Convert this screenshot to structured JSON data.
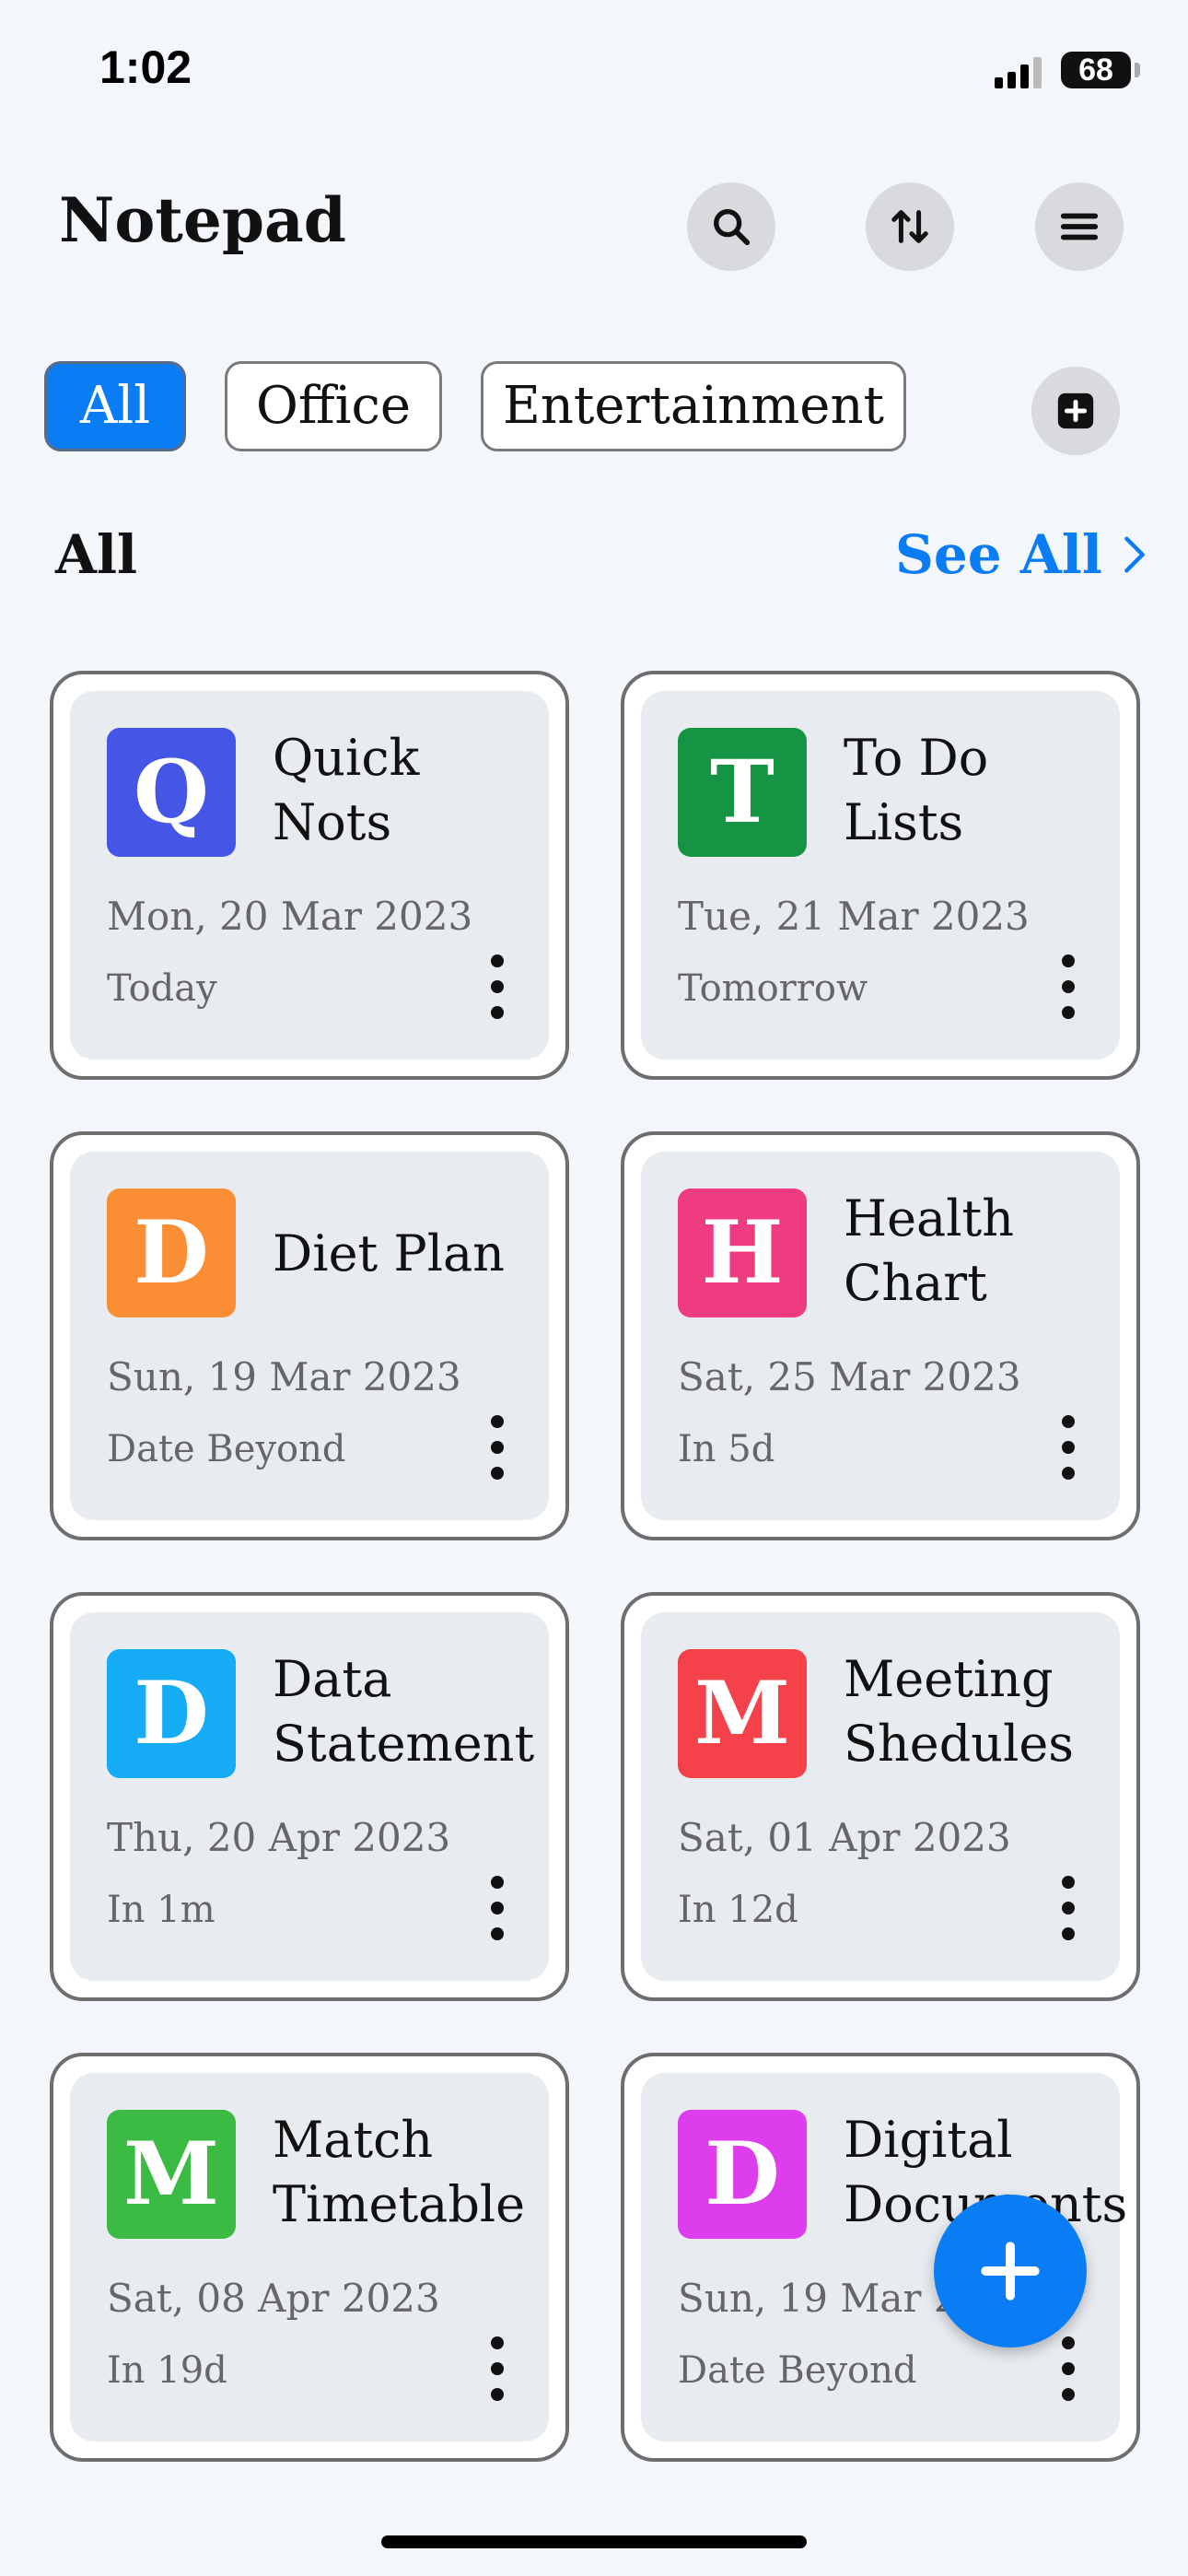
{
  "status_bar": {
    "time": "1:02",
    "battery": "68"
  },
  "header": {
    "title": "Notepad",
    "search_icon": "search-icon",
    "sort_icon": "sort-arrows-icon",
    "menu_icon": "hamburger-menu-icon"
  },
  "categories": [
    {
      "label": "All",
      "active": true
    },
    {
      "label": "Office",
      "active": false
    },
    {
      "label": "Entertainment",
      "active": false
    }
  ],
  "section": {
    "title": "All",
    "see_all": "See All"
  },
  "notes": [
    {
      "letter": "Q",
      "title": "Quick Nots",
      "date": "Mon, 20 Mar 2023",
      "due": "Today",
      "color": "#4556e6"
    },
    {
      "letter": "T",
      "title": "To Do Lists",
      "date": "Tue, 21 Mar 2023",
      "due": "Tomorrow",
      "color": "#159544"
    },
    {
      "letter": "D",
      "title": "Diet Plan",
      "date": "Sun, 19 Mar 2023",
      "due": "Date Beyond",
      "color": "#fb8d34"
    },
    {
      "letter": "H",
      "title": "Health Chart",
      "date": "Sat, 25 Mar 2023",
      "due": "In 5d",
      "color": "#ef3b7f"
    },
    {
      "letter": "D",
      "title": "Data Statement",
      "date": "Thu, 20 Apr 2023",
      "due": "In 1m",
      "color": "#16abf5"
    },
    {
      "letter": "M",
      "title": "Meeting Shedules",
      "date": "Sat, 01 Apr 2023",
      "due": "In 12d",
      "color": "#f4414a"
    },
    {
      "letter": "M",
      "title": "Match Timetable",
      "date": "Sat, 08 Apr 2023",
      "due": "In 19d",
      "color": "#3bba44"
    },
    {
      "letter": "D",
      "title": "Digital Documents",
      "date": "Sun, 19 Mar 2023",
      "due": "Date Beyond",
      "color": "#de3ded"
    }
  ],
  "colors": {
    "accent": "#0a7cf4",
    "background": "#f3f6fb"
  }
}
